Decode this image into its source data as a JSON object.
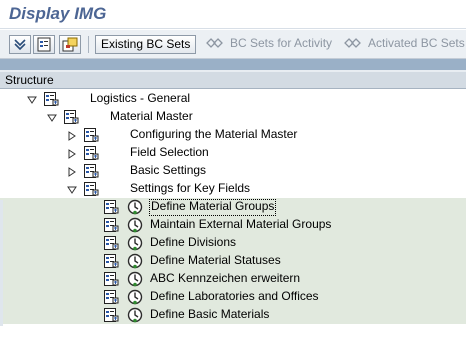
{
  "window": {
    "title": "Display IMG"
  },
  "toolbar": {
    "icons": [
      "expand-subtree-icon",
      "documentation-icon",
      "where-used-icon"
    ],
    "buttons": [
      {
        "label": "Existing BC Sets",
        "enabled": true
      },
      {
        "label": "BC Sets for Activity",
        "enabled": false
      },
      {
        "label": "Activated BC Sets",
        "enabled": false
      }
    ]
  },
  "tree": {
    "header": "Structure",
    "nodes": [
      {
        "label": "Logistics - General",
        "expanded": true,
        "has_clock": false,
        "level": 0
      },
      {
        "label": "Material Master",
        "expanded": true,
        "has_clock": false,
        "level": 1
      },
      {
        "label": "Configuring the Material Master",
        "expanded": false,
        "has_clock": false,
        "level": 2
      },
      {
        "label": "Field Selection",
        "expanded": false,
        "has_clock": false,
        "level": 2
      },
      {
        "label": "Basic Settings",
        "expanded": false,
        "has_clock": false,
        "level": 2
      },
      {
        "label": "Settings for Key Fields",
        "expanded": true,
        "has_clock": false,
        "level": 2
      },
      {
        "label": "Define Material Groups",
        "has_clock": true,
        "level": 3,
        "focused": true
      },
      {
        "label": "Maintain External Material Groups",
        "has_clock": true,
        "level": 3
      },
      {
        "label": "Define Divisions",
        "has_clock": true,
        "level": 3
      },
      {
        "label": "Define Material Statuses",
        "has_clock": true,
        "level": 3
      },
      {
        "label": "ABC Kennzeichen erweitern",
        "has_clock": true,
        "level": 3
      },
      {
        "label": "Define Laboratories and Offices",
        "has_clock": true,
        "level": 3
      },
      {
        "label": "Define Basic Materials",
        "has_clock": true,
        "level": 3
      }
    ]
  },
  "colors": {
    "title": "#4d6694",
    "highlight_row": "#e1e9de",
    "header": "#d3dbe3",
    "strip": "#9ab0c7"
  }
}
